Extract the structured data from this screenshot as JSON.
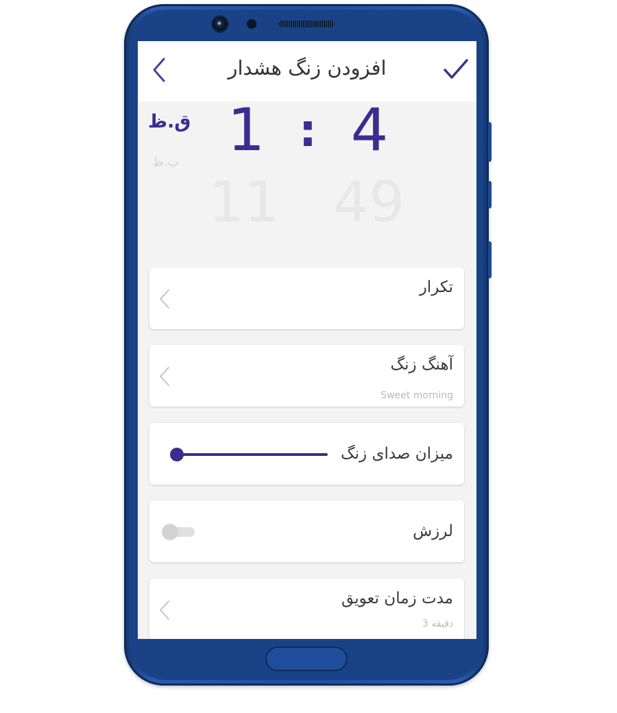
{
  "header": {
    "title": "افزودن زنگ هشدار",
    "back_icon": "chevron-left-icon",
    "confirm_icon": "checkmark-icon"
  },
  "time_picker": {
    "ampm_selected": "ق.ظ",
    "ampm_other": "ب.ظ",
    "hour_selected": "1",
    "separator": ":",
    "minute_selected": "4",
    "hour_next": "11",
    "minute_next": "49"
  },
  "settings": {
    "repeat": {
      "title": "تکرار"
    },
    "ringtone": {
      "title": "آهنگ زنگ",
      "value": "Sweet morning"
    },
    "volume": {
      "title": "میزان صدای زنگ",
      "level_percent": 0
    },
    "vibration": {
      "title": "لرزش",
      "enabled": false
    },
    "snooze": {
      "title": "مدت زمان تعویق",
      "value": "3 دقیقه"
    }
  },
  "colors": {
    "accent": "#3b2d8f",
    "screen_background": "#f3f3f3",
    "card_background": "#ffffff",
    "phone_frame": "#1f4f9f"
  }
}
